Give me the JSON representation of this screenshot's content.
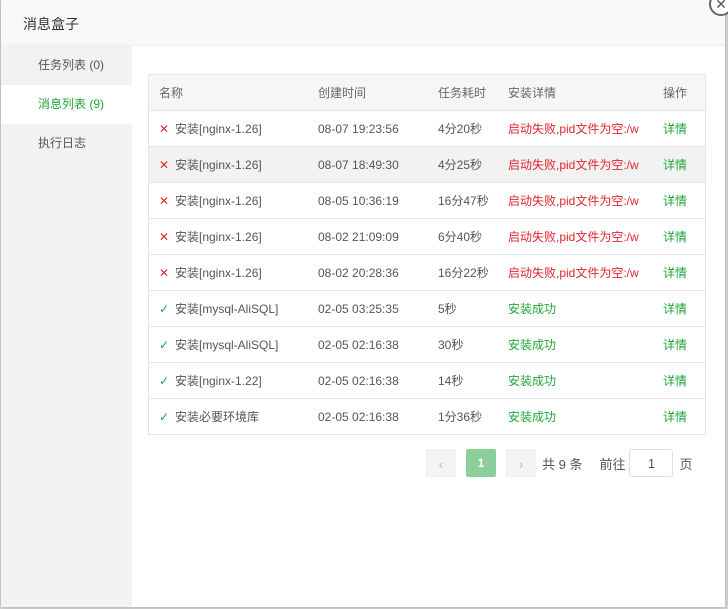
{
  "dialog": {
    "title": "消息盒子",
    "close_glyph": "✕"
  },
  "sidebar": {
    "items": [
      {
        "label": "任务列表 (0)"
      },
      {
        "label": "消息列表 (9)"
      },
      {
        "label": "执行日志"
      }
    ],
    "active_index": 1
  },
  "table": {
    "headers": [
      "名称",
      "创建时间",
      "任务耗时",
      "安装详情",
      "操作"
    ],
    "rows": [
      {
        "status": "fail",
        "name": "安装[nginx-1.26]",
        "time": "08-07 19:23:56",
        "duration": "4分20秒",
        "detail": "启动失败,pid文件为空:/w",
        "action": "详情"
      },
      {
        "status": "fail",
        "name": "安装[nginx-1.26]",
        "time": "08-07 18:49:30",
        "duration": "4分25秒",
        "detail": "启动失败,pid文件为空:/w",
        "action": "详情"
      },
      {
        "status": "fail",
        "name": "安装[nginx-1.26]",
        "time": "08-05 10:36:19",
        "duration": "16分47秒",
        "detail": "启动失败,pid文件为空:/w",
        "action": "详情"
      },
      {
        "status": "fail",
        "name": "安装[nginx-1.26]",
        "time": "08-02 21:09:09",
        "duration": "6分40秒",
        "detail": "启动失败,pid文件为空:/w",
        "action": "详情"
      },
      {
        "status": "fail",
        "name": "安装[nginx-1.26]",
        "time": "08-02 20:28:36",
        "duration": "16分22秒",
        "detail": "启动失败,pid文件为空:/w",
        "action": "详情"
      },
      {
        "status": "ok",
        "name": "安装[mysql-AliSQL]",
        "time": "02-05 03:25:35",
        "duration": "5秒",
        "detail": "安装成功",
        "action": "详情"
      },
      {
        "status": "ok",
        "name": "安装[mysql-AliSQL]",
        "time": "02-05 02:16:38",
        "duration": "30秒",
        "detail": "安装成功",
        "action": "详情"
      },
      {
        "status": "ok",
        "name": "安装[nginx-1.22]",
        "time": "02-05 02:16:38",
        "duration": "14秒",
        "detail": "安装成功",
        "action": "详情"
      },
      {
        "status": "ok",
        "name": "安装必要环境库",
        "time": "02-05 02:16:38",
        "duration": "1分36秒",
        "detail": "安装成功",
        "action": "详情"
      }
    ]
  },
  "pager": {
    "prev_glyph": "‹",
    "current_page": "1",
    "next_glyph": "›",
    "total_text": "共 9 条",
    "goto_label": "前往",
    "goto_value": "1",
    "page_suffix": "页"
  },
  "colors": {
    "accent": "#20a53a",
    "error": "#e0262d"
  }
}
